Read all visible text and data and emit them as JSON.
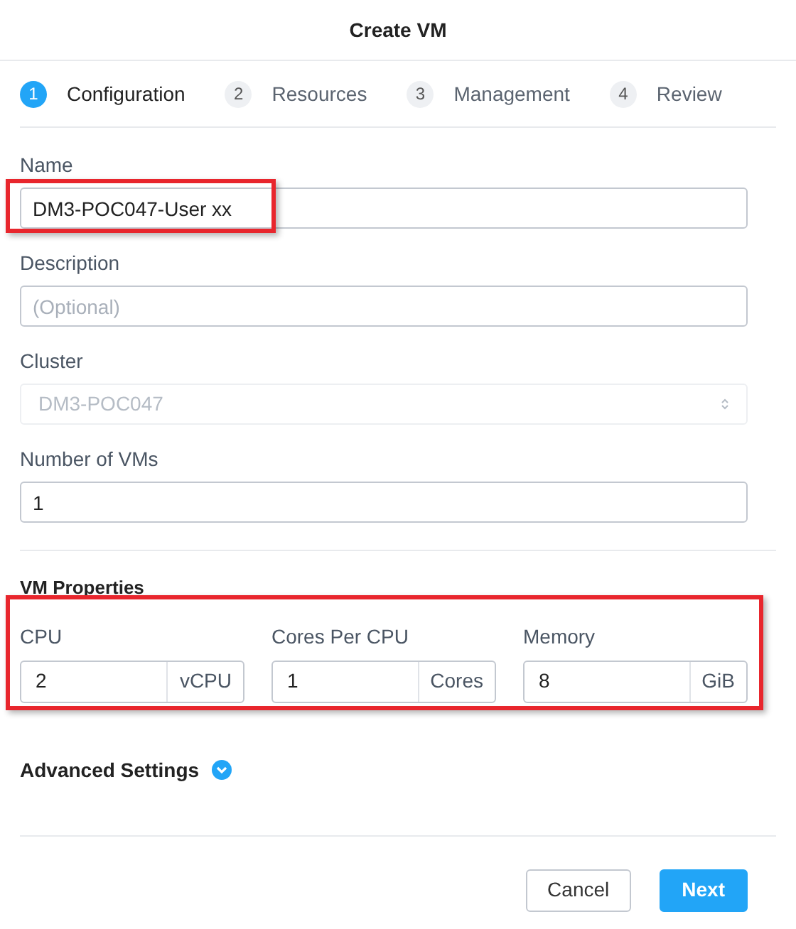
{
  "dialog": {
    "title": "Create VM"
  },
  "steps": [
    {
      "number": "1",
      "label": "Configuration",
      "selected": true
    },
    {
      "number": "2",
      "label": "Resources",
      "selected": false
    },
    {
      "number": "3",
      "label": "Management",
      "selected": false
    },
    {
      "number": "4",
      "label": "Review",
      "selected": false
    }
  ],
  "fields": [
    {
      "kind": "text",
      "label": "Name",
      "value": "DM3-POC047-User xx",
      "highlighted": true
    },
    {
      "kind": "text",
      "label": "Description",
      "placeholder": "(Optional)"
    },
    {
      "kind": "select",
      "label": "Cluster",
      "value": "DM3-POC047",
      "disabled": true
    },
    {
      "kind": "text",
      "label": "Number of VMs",
      "value": "1"
    }
  ],
  "vm_properties": {
    "title": "VM Properties",
    "highlighted": true,
    "fields": [
      {
        "label": "CPU",
        "value": "2",
        "unit": "vCPU"
      },
      {
        "label": "Cores Per CPU",
        "value": "1",
        "unit": "Cores"
      },
      {
        "label": "Memory",
        "value": "8",
        "unit": "GiB"
      }
    ]
  },
  "advanced": {
    "label": "Advanced Settings",
    "expanded": false
  },
  "buttons": [
    {
      "kind": "secondary",
      "label": "Cancel"
    },
    {
      "kind": "primary",
      "label": "Next"
    }
  ]
}
